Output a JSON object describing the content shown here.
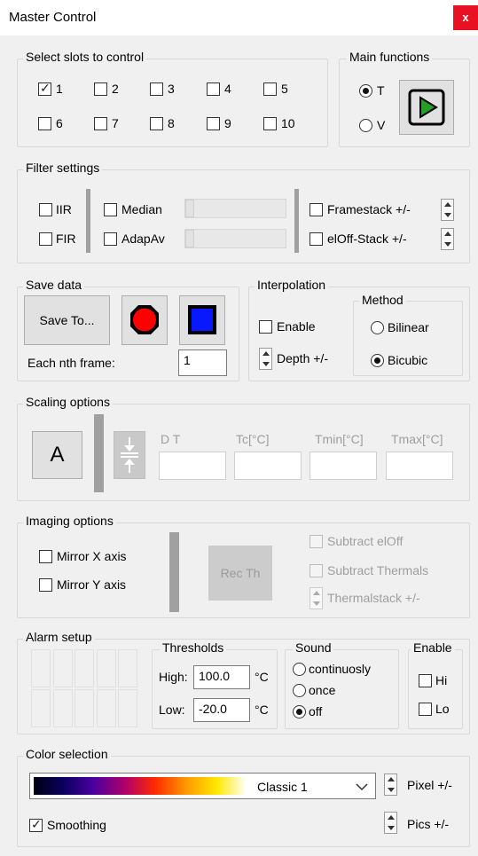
{
  "window": {
    "title": "Master Control",
    "close": "x"
  },
  "slots": {
    "legend": "Select slots to control",
    "items": [
      {
        "label": "1",
        "checked": true
      },
      {
        "label": "2",
        "checked": false
      },
      {
        "label": "3",
        "checked": false
      },
      {
        "label": "4",
        "checked": false
      },
      {
        "label": "5",
        "checked": false
      },
      {
        "label": "6",
        "checked": false
      },
      {
        "label": "7",
        "checked": false
      },
      {
        "label": "8",
        "checked": false
      },
      {
        "label": "9",
        "checked": false
      },
      {
        "label": "10",
        "checked": false
      }
    ]
  },
  "main_functions": {
    "legend": "Main functions",
    "t_label": "T",
    "v_label": "V",
    "selected": "T",
    "play_color": "#22a022"
  },
  "filter": {
    "legend": "Filter settings",
    "iir": "IIR",
    "fir": "FIR",
    "median": "Median",
    "adapav": "AdapAv",
    "framestack": "Framestack +/-",
    "eloffstack": "elOff-Stack +/-"
  },
  "save_data": {
    "legend": "Save data",
    "save_to": "Save To...",
    "nth_label": "Each nth frame:",
    "nth_value": "1",
    "record_color": "#ff0000",
    "stop_color": "#0a18ff"
  },
  "interpolation": {
    "legend": "Interpolation",
    "enable": "Enable",
    "depth": "Depth +/-",
    "method_legend": "Method",
    "bilinear": "Bilinear",
    "bicubic": "Bicubic",
    "selected": "Bicubic"
  },
  "scaling": {
    "legend": "Scaling options",
    "auto_button": "A",
    "dt_label": "D  T",
    "tc_label": "Tc[°C]",
    "tmin_label": "Tmin[°C]",
    "tmax_label": "Tmax[°C]"
  },
  "imaging": {
    "legend": "Imaging options",
    "mirror_x": "Mirror X axis",
    "mirror_y": "Mirror Y axis",
    "rec_th": "Rec Th",
    "subtract_eloff": "Subtract elOff",
    "subtract_thermals": "Subtract Thermals",
    "thermalstack": "Thermalstack +/-"
  },
  "alarm": {
    "legend": "Alarm setup",
    "thresholds_legend": "Thresholds",
    "high_label": "High:",
    "high_value": "100.0",
    "low_label": "Low:",
    "low_value": "-20.0",
    "unit": "°C",
    "sound_legend": "Sound",
    "continuosly": "continuosly",
    "once": "once",
    "off": "off",
    "sound_selected": "off",
    "enable_legend": "Enable",
    "hi": "Hi",
    "lo": "Lo"
  },
  "color": {
    "legend": "Color selection",
    "palette": "Classic 1",
    "pixel": "Pixel +/-",
    "smoothing": "Smoothing",
    "smoothing_checked": true,
    "pics": "Pics +/-"
  }
}
